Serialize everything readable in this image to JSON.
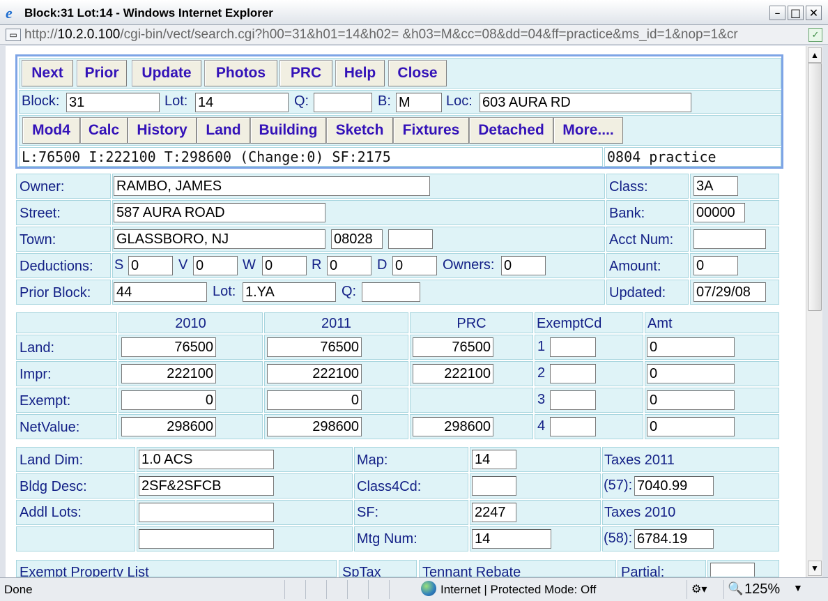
{
  "window": {
    "title": "Block:31 Lot:14 - Windows Internet Explorer"
  },
  "address": {
    "prefix": "http://",
    "host": "10.2.0.100",
    "path": "/cgi-bin/vect/search.cgi?h00=31&h01=14&h02= &h03=M&cc=08&dd=04&ff=practice&ms_id=1&nop=1&cr"
  },
  "toolbar1": [
    "Next",
    "Prior",
    "Update",
    "Photos",
    "PRC",
    "Help",
    "Close"
  ],
  "lookup": {
    "block_label": "Block:",
    "block": "31",
    "lot_label": "Lot:",
    "lot": "14",
    "q_label": "Q:",
    "q": "",
    "b_label": "B:",
    "b": "M",
    "loc_label": "Loc:",
    "loc": "603 AURA RD"
  },
  "toolbar2": [
    "Mod4",
    "Calc",
    "History",
    "Land",
    "Building",
    "Sketch",
    "Fixtures",
    "Detached",
    "More...."
  ],
  "summary": {
    "line": "L:76500 I:222100 T:298600 (Change:0) SF:2175",
    "db": "0804 practice"
  },
  "owner": {
    "owner_label": "Owner:",
    "owner": "RAMBO, JAMES",
    "street_label": "Street:",
    "street": "587 AURA ROAD",
    "town_label": "Town:",
    "town": "GLASSBORO, NJ",
    "zip": "08028",
    "zip4": "",
    "deductions_label": "Deductions:",
    "s_label": "S",
    "s": "0",
    "v_label": "V",
    "v": "0",
    "w_label": "W",
    "w": "0",
    "r_label": "R",
    "r": "0",
    "d_label": "D",
    "d": "0",
    "owners_label": "Owners:",
    "owners": "0",
    "prior_block_label": "Prior Block:",
    "prior_block": "44",
    "lot_label": "Lot:",
    "lot": "1.YA",
    "q_label": "Q:",
    "q": "",
    "class_label": "Class:",
    "class": "3A",
    "bank_label": "Bank:",
    "bank": "00000",
    "acct_label": "Acct Num:",
    "acct": "",
    "amount_label": "Amount:",
    "amount": "0",
    "updated_label": "Updated:",
    "updated": "07/29/08"
  },
  "values": {
    "headers": [
      "2010",
      "2011",
      "PRC",
      "ExemptCd",
      "Amt"
    ],
    "rows": [
      {
        "label": "Land:",
        "y2010": "76500",
        "y2011": "76500",
        "prc": "76500",
        "code_no": "1",
        "code": "",
        "amt": "0"
      },
      {
        "label": "Impr:",
        "y2010": "222100",
        "y2011": "222100",
        "prc": "222100",
        "code_no": "2",
        "code": "",
        "amt": "0"
      },
      {
        "label": "Exempt:",
        "y2010": "0",
        "y2011": "0",
        "prc": "",
        "code_no": "3",
        "code": "",
        "amt": "0"
      },
      {
        "label": "NetValue:",
        "y2010": "298600",
        "y2011": "298600",
        "prc": "298600",
        "code_no": "4",
        "code": "",
        "amt": "0"
      }
    ]
  },
  "details": {
    "land_dim_label": "Land Dim:",
    "land_dim": "1.0 ACS",
    "bldg_desc_label": "Bldg Desc:",
    "bldg_desc": "2SF&2SFCB",
    "addl_lots_label": "Addl Lots:",
    "addl_lots": "",
    "addl_lots2": "",
    "map_label": "Map:",
    "map": "14",
    "class4_label": "Class4Cd:",
    "class4": "",
    "sf_label": "SF:",
    "sf": "2247",
    "mtg_label": "Mtg Num:",
    "mtg": "14",
    "taxes2011_label": "Taxes 2011",
    "t57_label": "(57):",
    "t57": "7040.99",
    "taxes2010_label": "Taxes 2010",
    "t58_label": "(58):",
    "t58": "6784.19"
  },
  "bottom": {
    "exempt_list": "Exempt Property List",
    "sptax": "SpTax",
    "tennant": "Tennant Rebate",
    "partial": "Partial:"
  },
  "status": {
    "done": "Done",
    "zone": "Internet | Protected Mode: Off",
    "zoom": "125%"
  }
}
